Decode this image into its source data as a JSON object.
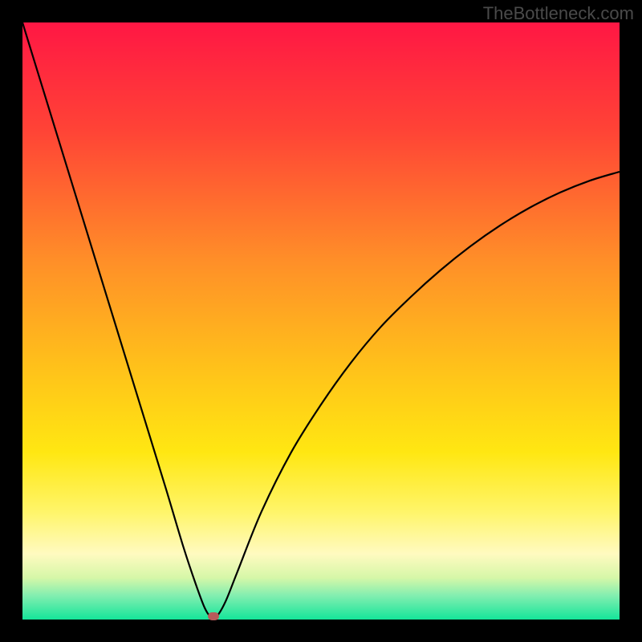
{
  "watermark": "TheBottleneck.com",
  "chart_data": {
    "type": "line",
    "title": "",
    "xlabel": "",
    "ylabel": "",
    "xlim": [
      0,
      100
    ],
    "ylim": [
      0,
      100
    ],
    "grid": false,
    "legend": false,
    "gradient_stops": [
      {
        "offset": 0,
        "color": "#ff1744"
      },
      {
        "offset": 18,
        "color": "#ff4336"
      },
      {
        "offset": 40,
        "color": "#ff8f28"
      },
      {
        "offset": 58,
        "color": "#ffc21a"
      },
      {
        "offset": 72,
        "color": "#ffe712"
      },
      {
        "offset": 82,
        "color": "#fff56a"
      },
      {
        "offset": 89,
        "color": "#fffac0"
      },
      {
        "offset": 93,
        "color": "#d6f7a8"
      },
      {
        "offset": 96,
        "color": "#82eeb0"
      },
      {
        "offset": 100,
        "color": "#14e59a"
      }
    ],
    "series": [
      {
        "name": "bottleneck-curve",
        "color": "#000000",
        "x": [
          0,
          4,
          8,
          12,
          16,
          20,
          24,
          27,
          29,
          30.5,
          31.5,
          32.5,
          34,
          36,
          40,
          45,
          50,
          55,
          60,
          65,
          70,
          75,
          80,
          85,
          90,
          95,
          100
        ],
        "y": [
          100,
          87,
          74,
          61,
          48,
          35,
          22,
          12,
          6,
          2,
          0.5,
          0.5,
          3,
          8,
          18,
          28,
          36,
          43,
          49,
          54,
          58.5,
          62.5,
          66,
          69,
          71.5,
          73.5,
          75
        ]
      }
    ],
    "marker": {
      "x": 32,
      "y": 0.5,
      "color": "#b85a5a"
    }
  }
}
